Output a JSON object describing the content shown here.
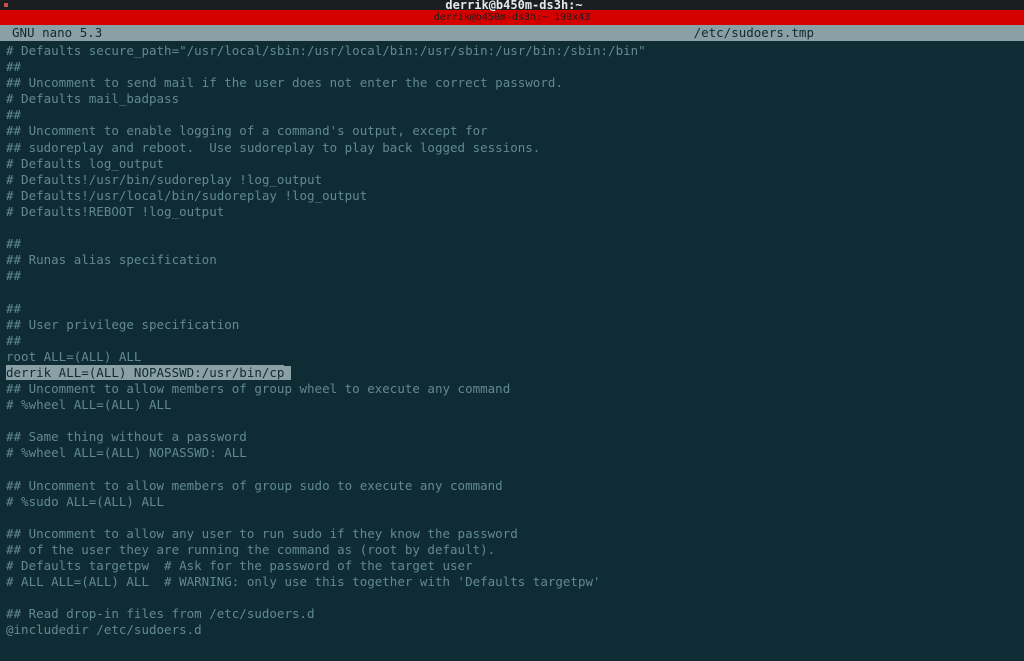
{
  "window": {
    "title": "derrik@b450m-ds3h:~",
    "subtitle": "derrik@b450m-ds3h:~ 190x43"
  },
  "status": {
    "app": "  GNU nano 5.3",
    "file": "/etc/sudoers.tmp"
  },
  "editor": {
    "lines": [
      "# Defaults secure_path=\"/usr/local/sbin:/usr/local/bin:/usr/sbin:/usr/bin:/sbin:/bin\"",
      "##",
      "## Uncomment to send mail if the user does not enter the correct password.",
      "# Defaults mail_badpass",
      "##",
      "## Uncomment to enable logging of a command's output, except for",
      "## sudoreplay and reboot.  Use sudoreplay to play back logged sessions.",
      "# Defaults log_output",
      "# Defaults!/usr/bin/sudoreplay !log_output",
      "# Defaults!/usr/local/bin/sudoreplay !log_output",
      "# Defaults!REBOOT !log_output",
      "",
      "##",
      "## Runas alias specification",
      "##",
      "",
      "##",
      "## User privilege specification",
      "##",
      "root ALL=(ALL) ALL",
      "derrik ALL=(ALL) NOPASSWD:/usr/bin/cp",
      "## Uncomment to allow members of group wheel to execute any command",
      "# %wheel ALL=(ALL) ALL",
      "",
      "## Same thing without a password",
      "# %wheel ALL=(ALL) NOPASSWD: ALL",
      "",
      "## Uncomment to allow members of group sudo to execute any command",
      "# %sudo ALL=(ALL) ALL",
      "",
      "## Uncomment to allow any user to run sudo if they know the password",
      "## of the user they are running the command as (root by default).",
      "# Defaults targetpw  # Ask for the password of the target user",
      "# ALL ALL=(ALL) ALL  # WARNING: only use this together with 'Defaults targetpw'",
      "",
      "## Read drop-in files from /etc/sudoers.d",
      "@includedir /etc/sudoers.d"
    ],
    "highlighted_index": 20
  }
}
